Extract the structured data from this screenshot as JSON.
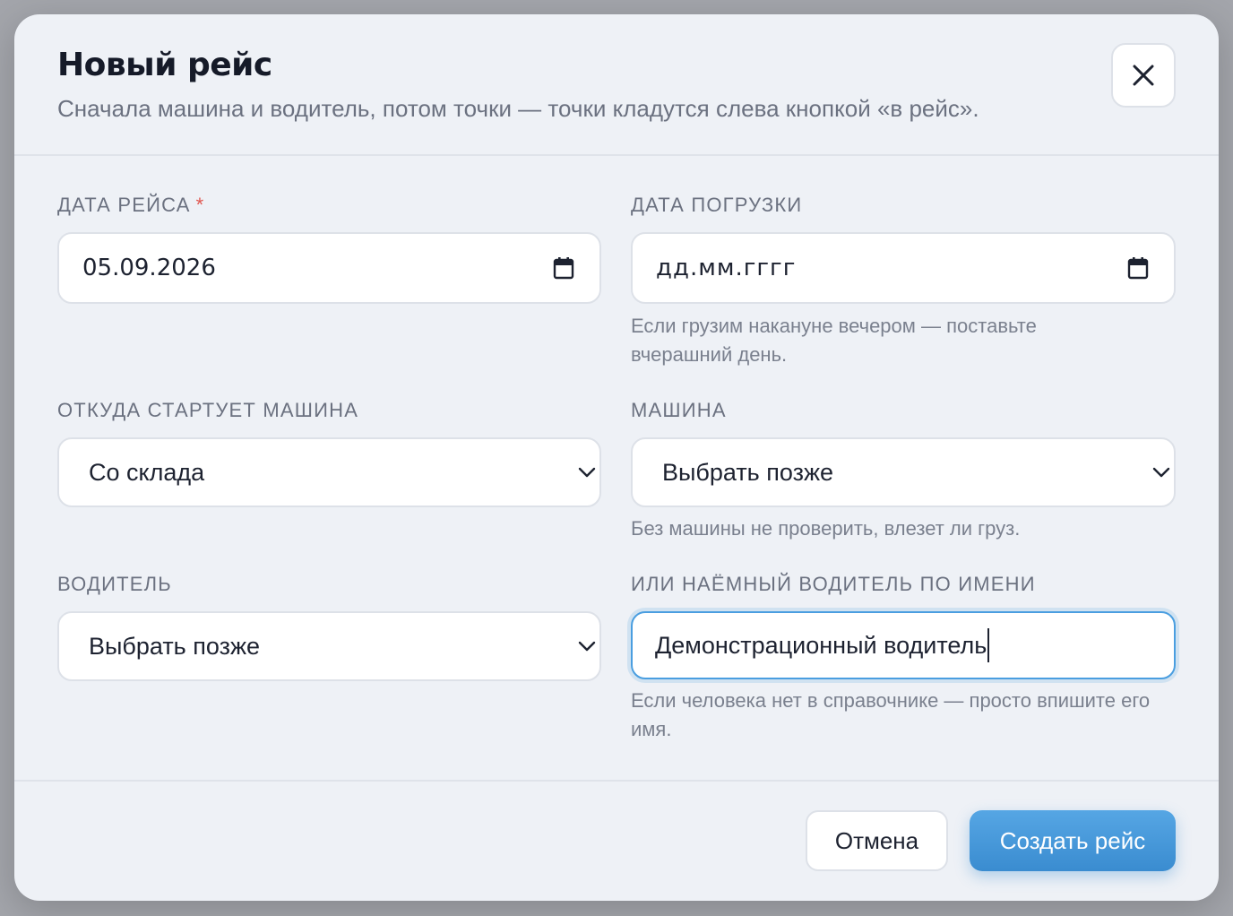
{
  "dialog": {
    "title": "Новый рейс",
    "subtitle": "Сначала машина и водитель, потом точки — точки кладутся слева кнопкой «в рейс».",
    "close_icon": "close-icon"
  },
  "form": {
    "trip_date": {
      "label": "ДАТА РЕЙСА",
      "required_mark": "*",
      "value": "05.09.2026",
      "icon": "calendar-icon"
    },
    "load_date": {
      "label": "ДАТА ПОГРУЗКИ",
      "placeholder": "дд.мм.гггг",
      "icon": "calendar-icon",
      "hint": "Если грузим накануне вечером — поставьте вчерашний день."
    },
    "start_from": {
      "label": "ОТКУДА СТАРТУЕТ МАШИНА",
      "selected": "Со склада",
      "icon": "chevron-down-icon"
    },
    "vehicle": {
      "label": "МАШИНА",
      "selected": "Выбрать позже",
      "icon": "chevron-down-icon",
      "hint": "Без машины не проверить, влезет ли груз."
    },
    "driver": {
      "label": "ВОДИТЕЛЬ",
      "selected": "Выбрать позже",
      "icon": "chevron-down-icon"
    },
    "hired_driver": {
      "label": "ИЛИ НАЁМНЫЙ ВОДИТЕЛЬ ПО ИМЕНИ",
      "value": "Демонстрационный водитель",
      "hint": "Если человека нет в справочнике — просто впишите его имя."
    }
  },
  "footer": {
    "cancel_label": "Отмена",
    "submit_label": "Создать рейс"
  },
  "colors": {
    "accent": "#4a9ee0",
    "required": "#e0564f",
    "panel": "#eef1f6"
  }
}
